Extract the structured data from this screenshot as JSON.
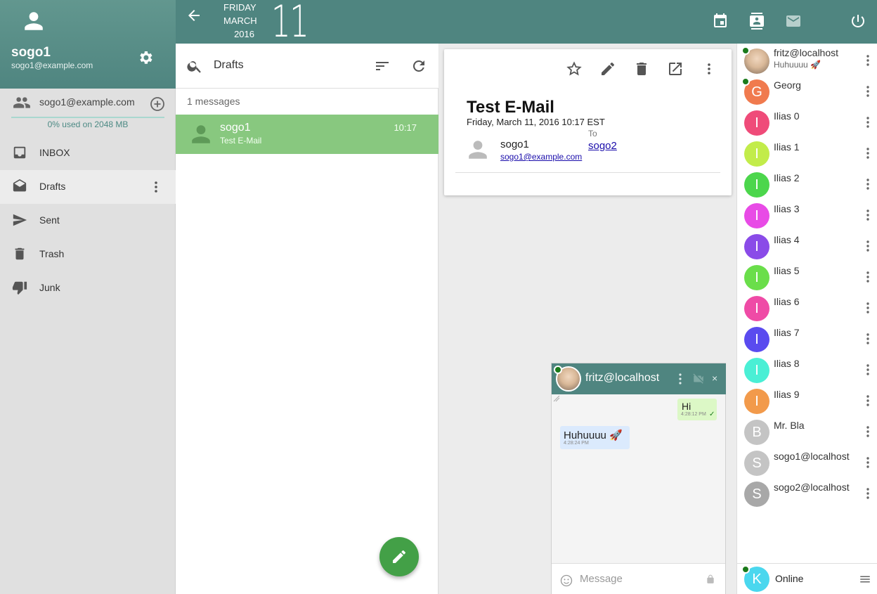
{
  "colors": {
    "header": "#4f8580",
    "accent": "#43a047",
    "selected_row": "#88c87f",
    "online": "#1b7a1b"
  },
  "user": {
    "name": "sogo1",
    "email": "sogo1@example.com"
  },
  "account": {
    "label": "sogo1@example.com",
    "quota": "0% used on 2048 MB",
    "quota_fraction": 0.0
  },
  "folders": [
    {
      "label": "INBOX",
      "icon": "inbox-icon"
    },
    {
      "label": "Drafts",
      "icon": "drafts-icon"
    },
    {
      "label": "Sent",
      "icon": "send-icon"
    },
    {
      "label": "Trash",
      "icon": "trash-icon"
    },
    {
      "label": "Junk",
      "icon": "thumb-down-icon"
    }
  ],
  "date": {
    "weekday": "FRIDAY",
    "month": "MARCH",
    "year": "2016",
    "day": "11"
  },
  "list": {
    "folder": "Drafts",
    "count": "1 messages",
    "messages": [
      {
        "from": "sogo1",
        "subject": "Test E-Mail",
        "time": "10:17"
      }
    ]
  },
  "message": {
    "subject": "Test E-Mail",
    "date": "Friday, March 11, 2016 10:17 EST",
    "from_name": "sogo1",
    "from_email": "sogo1@example.com",
    "to_label": "To",
    "to": "sogo2"
  },
  "chat": {
    "title": "fritz@localhost",
    "messages": [
      {
        "text": "Hi",
        "time": "4:28:12 PM",
        "direction": "out"
      },
      {
        "text": "Huhuuuu 🚀",
        "time": "4:28:24 PM",
        "direction": "in"
      }
    ],
    "placeholder": "Message"
  },
  "roster": [
    {
      "name": "fritz@localhost",
      "status": "Huhuuuu 🚀",
      "initial": "",
      "color": "#c8b49a",
      "online": true,
      "photo": true
    },
    {
      "name": "Georg",
      "initial": "G",
      "color": "#f07a4e",
      "online": true
    },
    {
      "name": "Ilias 0",
      "initial": "I",
      "color": "#ef4b79",
      "online": false
    },
    {
      "name": "Ilias 1",
      "initial": "I",
      "color": "#c2ec4a",
      "online": false
    },
    {
      "name": "Ilias 2",
      "initial": "I",
      "color": "#4cd64c",
      "online": false
    },
    {
      "name": "Ilias 3",
      "initial": "I",
      "color": "#e84be6",
      "online": false
    },
    {
      "name": "Ilias 4",
      "initial": "I",
      "color": "#8a4be8",
      "online": false
    },
    {
      "name": "Ilias 5",
      "initial": "I",
      "color": "#6ade4a",
      "online": false
    },
    {
      "name": "Ilias 6",
      "initial": "I",
      "color": "#ef4ba6",
      "online": false
    },
    {
      "name": "Ilias 7",
      "initial": "I",
      "color": "#5a4bef",
      "online": false
    },
    {
      "name": "Ilias 8",
      "initial": "I",
      "color": "#4aefd5",
      "online": false
    },
    {
      "name": "Ilias 9",
      "initial": "I",
      "color": "#f29a4b",
      "online": false
    },
    {
      "name": "Mr. Bla",
      "initial": "B",
      "color": "#c4c4c4",
      "online": false
    },
    {
      "name": "sogo1@localhost",
      "initial": "S",
      "color": "#c4c4c4",
      "online": false
    },
    {
      "name": "sogo2@localhost",
      "initial": "S",
      "color": "#a8a8a8",
      "online": false
    }
  ],
  "presence": {
    "initial": "K",
    "color": "#4ad7ee",
    "label": "Online"
  }
}
